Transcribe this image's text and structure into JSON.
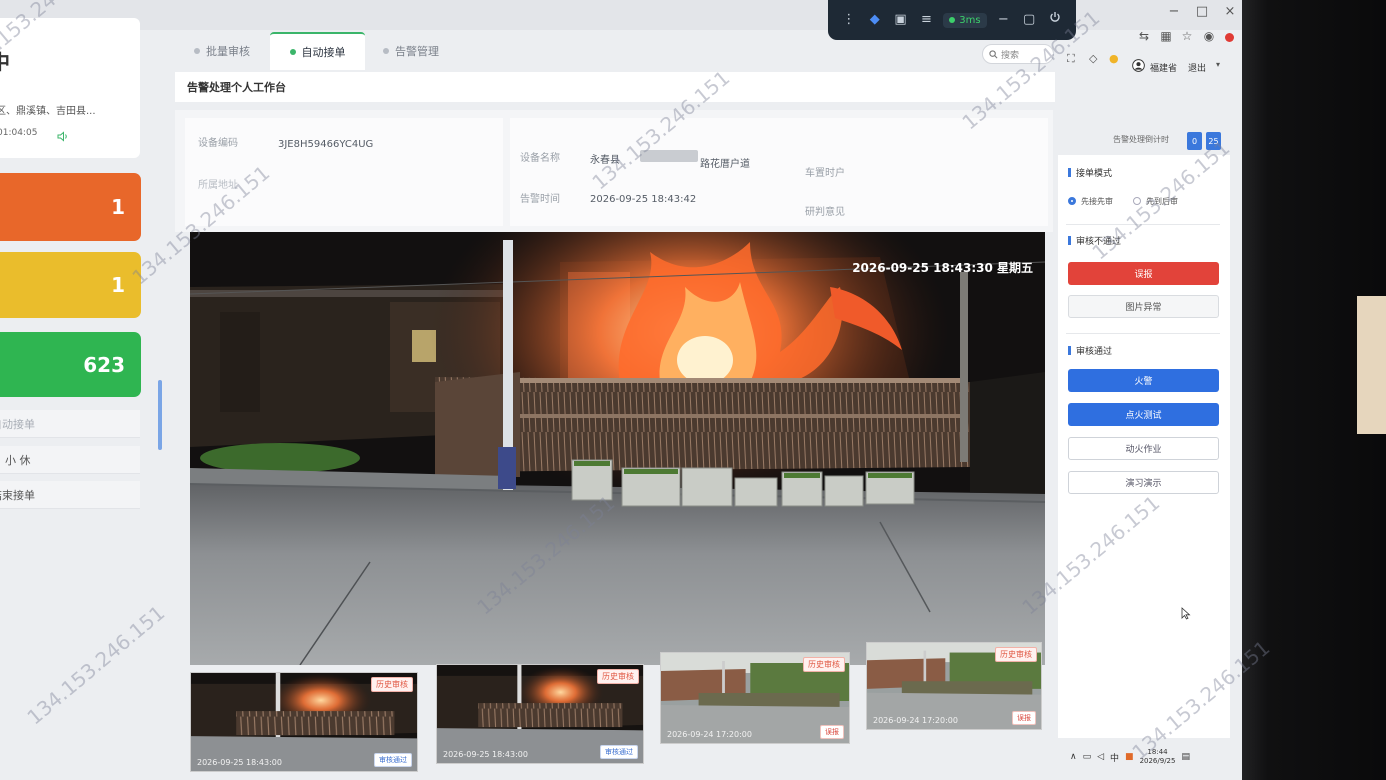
{
  "watermark": "134.153.246.151",
  "toolbar": {
    "latency": "3ms"
  },
  "tabs": [
    {
      "label": "批量审核",
      "active": false
    },
    {
      "label": "自动接单",
      "active": true
    },
    {
      "label": "告警管理",
      "active": false
    }
  ],
  "header": {
    "search_placeholder": "搜索",
    "user": "福建省",
    "logout": "退出"
  },
  "page_title": "告警处理个人工作台",
  "device": {
    "code_label": "设备编码",
    "code": "3JE8H59466YC4UG",
    "address_label": "所属地址",
    "name_label": "设备名称",
    "name_prefix": "永春县",
    "name_suffix": "路花厝户道",
    "field3_label": "车置时户",
    "time_label": "告警时间",
    "time": "2026-09-25 18:43:42",
    "opinion_label": "研判意见"
  },
  "countdown": {
    "label": "告警处理倒计时",
    "minutes": "0",
    "seconds": "25"
  },
  "panel": {
    "mode_label": "接单模式",
    "mode_options": [
      "先接先审",
      "先到后审"
    ],
    "reject_label": "审核不通过",
    "reject_buttons": [
      "误报",
      "图片异常"
    ],
    "approve_label": "审核通过",
    "approve_buttons": [
      "火警",
      "点火测试",
      "动火作业",
      "演习演示"
    ]
  },
  "camera": {
    "timestamp": "2026-09-25 18:43:30 星期五"
  },
  "history": [
    {
      "tag": "历史审核",
      "time": "2026-09-25 18:43:00",
      "status": "审核通过"
    },
    {
      "tag": "历史审核",
      "time": "2026-09-25 18:43:00",
      "status": "审核通过"
    },
    {
      "tag": "历史审核",
      "time": "2026-09-24 17:20:00",
      "status": "误报"
    },
    {
      "tag": "历史审核",
      "time": "2026-09-24 17:20:00",
      "status": "误报"
    }
  ],
  "sidebar": {
    "header_char": "中",
    "region": "区、鼎溪镇、吉田县...",
    "time": "01:04:05",
    "stats": [
      {
        "value": "1",
        "color": "#e8672a"
      },
      {
        "value": "1",
        "color": "#eabd2c"
      },
      {
        "value": "623",
        "color": "#2fb551"
      }
    ],
    "menu": [
      "自动接单",
      "小 休",
      "结束接单"
    ]
  },
  "taskbar": {
    "time": "18:44",
    "date": "2026/9/25"
  },
  "colors": {
    "primary": "#2f6fe0",
    "danger": "#e2433a",
    "success": "#3bb56a"
  }
}
